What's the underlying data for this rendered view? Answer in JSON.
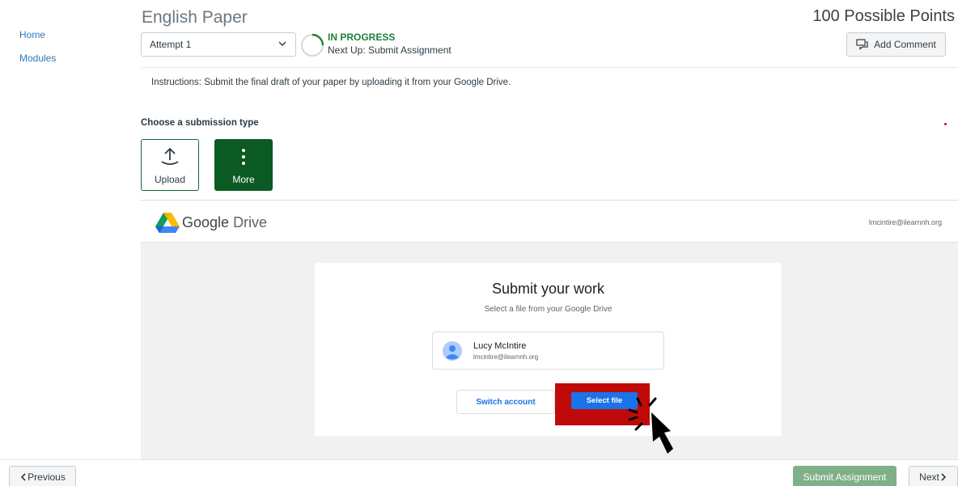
{
  "nav": {
    "home": "Home",
    "modules": "Modules"
  },
  "header": {
    "title": "English Paper",
    "points": "100 Possible Points",
    "attempt": "Attempt 1",
    "status": "IN PROGRESS",
    "next_up": "Next Up: Submit Assignment",
    "add_comment": "Add Comment"
  },
  "instructions": "Instructions: Submit the final draft of your paper by uploading it from your Google Drive.",
  "submission": {
    "label": "Choose a submission type",
    "types": [
      {
        "label": "Upload",
        "icon": "upload-icon"
      },
      {
        "label": "More",
        "icon": "more-vertical-icon"
      }
    ]
  },
  "drive": {
    "brand_google": "Google",
    "brand_drive": "Drive",
    "header_email": "lmcintire@ilearnnh.org",
    "card_title": "Submit your work",
    "card_subtitle": "Select a file from your Google Drive",
    "account_name": "Lucy McIntire",
    "account_email": "lmcintire@ilearnnh.org",
    "switch_account": "Switch account",
    "select_file": "Select file"
  },
  "footer": {
    "previous": "Previous",
    "submit": "Submit Assignment",
    "next": "Next"
  },
  "colors": {
    "brand_green": "#0b5a23",
    "status_green": "#1f7f3a",
    "link_blue": "#2b7abc",
    "google_blue": "#1a73e8",
    "highlight_red": "#c00a0a"
  }
}
